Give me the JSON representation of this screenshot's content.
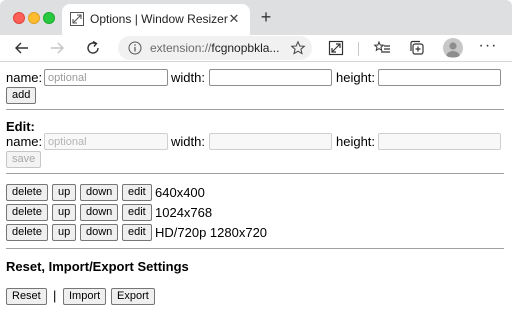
{
  "browser": {
    "tab_title": "Options | Window Resizer",
    "tab_close_glyph": "✕",
    "new_tab_glyph": "+",
    "address_scheme": "extension://",
    "address_rest": "fcgnopbkla...",
    "menu_glyph": "···",
    "icons": [
      "window-resize-icon",
      "back-arrow-icon",
      "forward-arrow-icon",
      "reload-icon",
      "info-icon",
      "star-icon",
      "extension-resize-icon",
      "favorites-icon",
      "collections-icon",
      "profile-avatar-icon",
      "more-menu-icon"
    ]
  },
  "add_form": {
    "name_label": "name:",
    "name_placeholder": "optional",
    "width_label": "width:",
    "height_label": "height:",
    "add_button": "add"
  },
  "edit_form": {
    "heading": "Edit:",
    "name_label": "name:",
    "name_placeholder": "optional",
    "width_label": "width:",
    "height_label": "height:",
    "save_button": "save"
  },
  "presets": {
    "buttons": {
      "delete": "delete",
      "up": "up",
      "down": "down",
      "edit": "edit"
    },
    "items": [
      {
        "label": "640x400"
      },
      {
        "label": "1024x768"
      },
      {
        "label": "HD/720p 1280x720"
      }
    ]
  },
  "settings": {
    "heading": "Reset, Import/Export Settings",
    "reset_button": "Reset",
    "separator": "|",
    "import_button": "Import",
    "export_button": "Export"
  },
  "colors": {
    "tab_strip": "#dedfe1",
    "close": "#fe5f57",
    "minimize": "#febc2e",
    "maximize": "#28c840"
  }
}
